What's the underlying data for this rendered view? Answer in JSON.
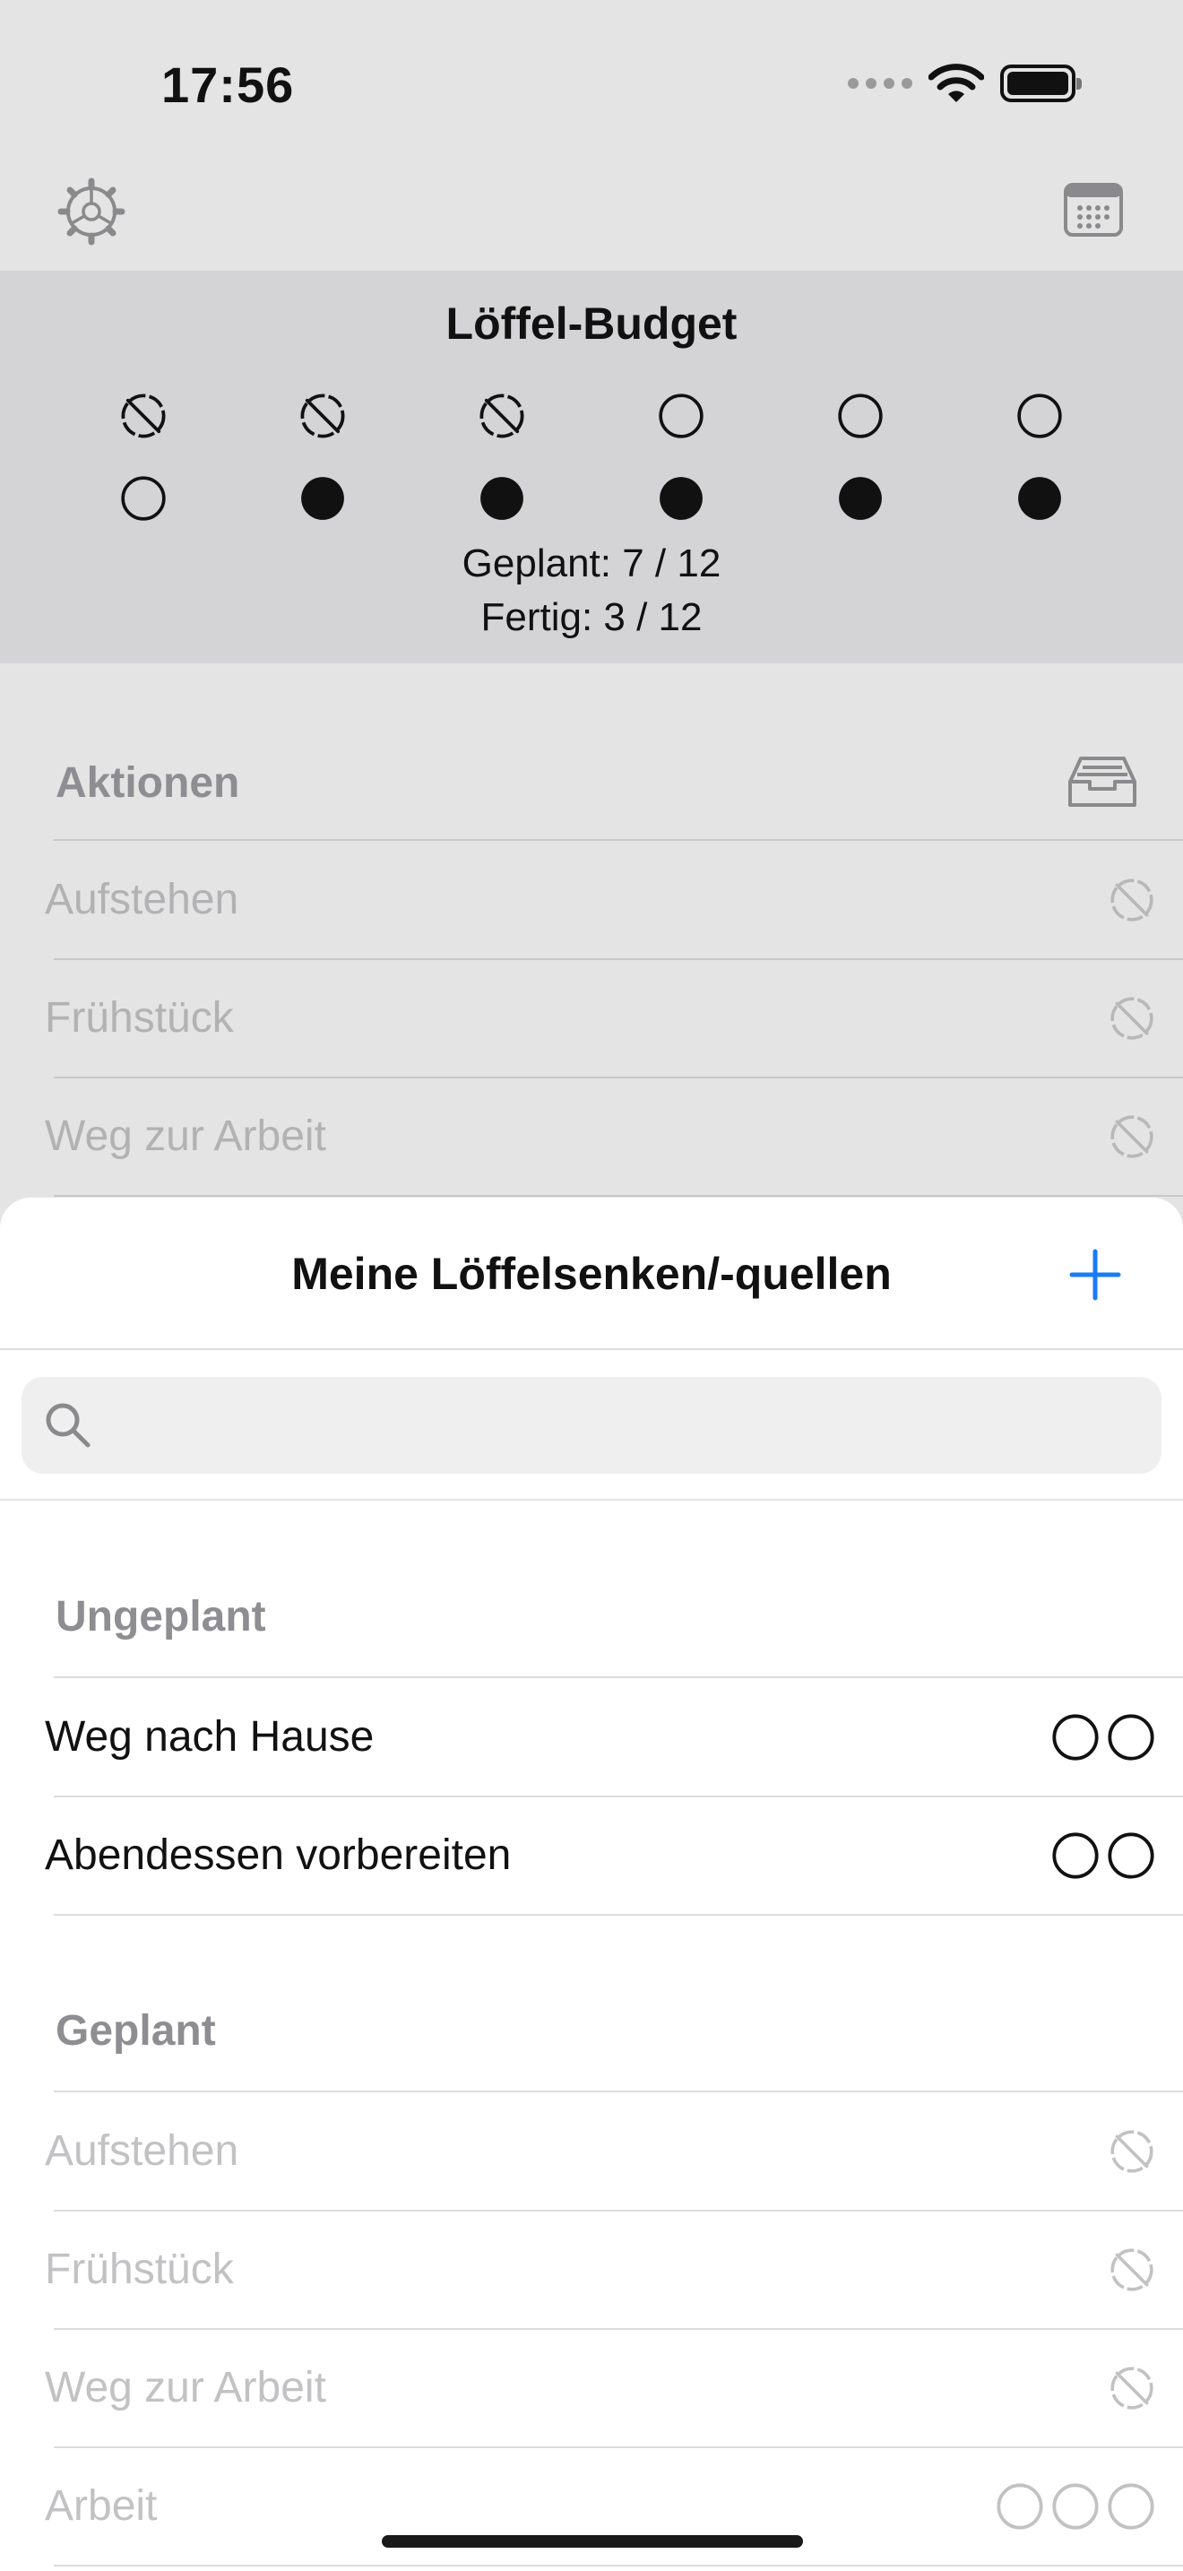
{
  "status_bar": {
    "time": "17:56"
  },
  "budget": {
    "title": "Löffel-Budget",
    "planned_text": "Geplant: 7 / 12",
    "done_text": "Fertig: 3 / 12",
    "top_row": [
      "used",
      "used",
      "used",
      "empty",
      "empty",
      "empty"
    ],
    "bottom_row": [
      "empty",
      "filled",
      "filled",
      "filled",
      "filled",
      "filled"
    ]
  },
  "actions_section": {
    "header": "Aktionen",
    "items": [
      {
        "label": "Aufstehen",
        "icon": "spoon-used-icon"
      },
      {
        "label": "Frühstück",
        "icon": "spoon-used-icon"
      },
      {
        "label": "Weg zur Arbeit",
        "icon": "spoon-used-icon"
      }
    ]
  },
  "sheet": {
    "title": "Meine Löffelsenken/-quellen",
    "search_placeholder": "",
    "unplanned": {
      "header": "Ungeplant",
      "items": [
        {
          "label": "Weg nach Hause",
          "spoons": 2
        },
        {
          "label": "Abendessen vorbereiten",
          "spoons": 2
        }
      ]
    },
    "planned": {
      "header": "Geplant",
      "items": [
        {
          "label": "Aufstehen",
          "icon": "spoon-used-icon"
        },
        {
          "label": "Frühstück",
          "icon": "spoon-used-icon"
        },
        {
          "label": "Weg zur Arbeit",
          "icon": "spoon-used-icon"
        },
        {
          "label": "Arbeit",
          "spoons": 3
        }
      ]
    }
  },
  "colors": {
    "accent": "#1a7cf5",
    "background": "#e4e4e4",
    "budget_band": "#d4d4d6",
    "sheet": "#ffffff"
  }
}
